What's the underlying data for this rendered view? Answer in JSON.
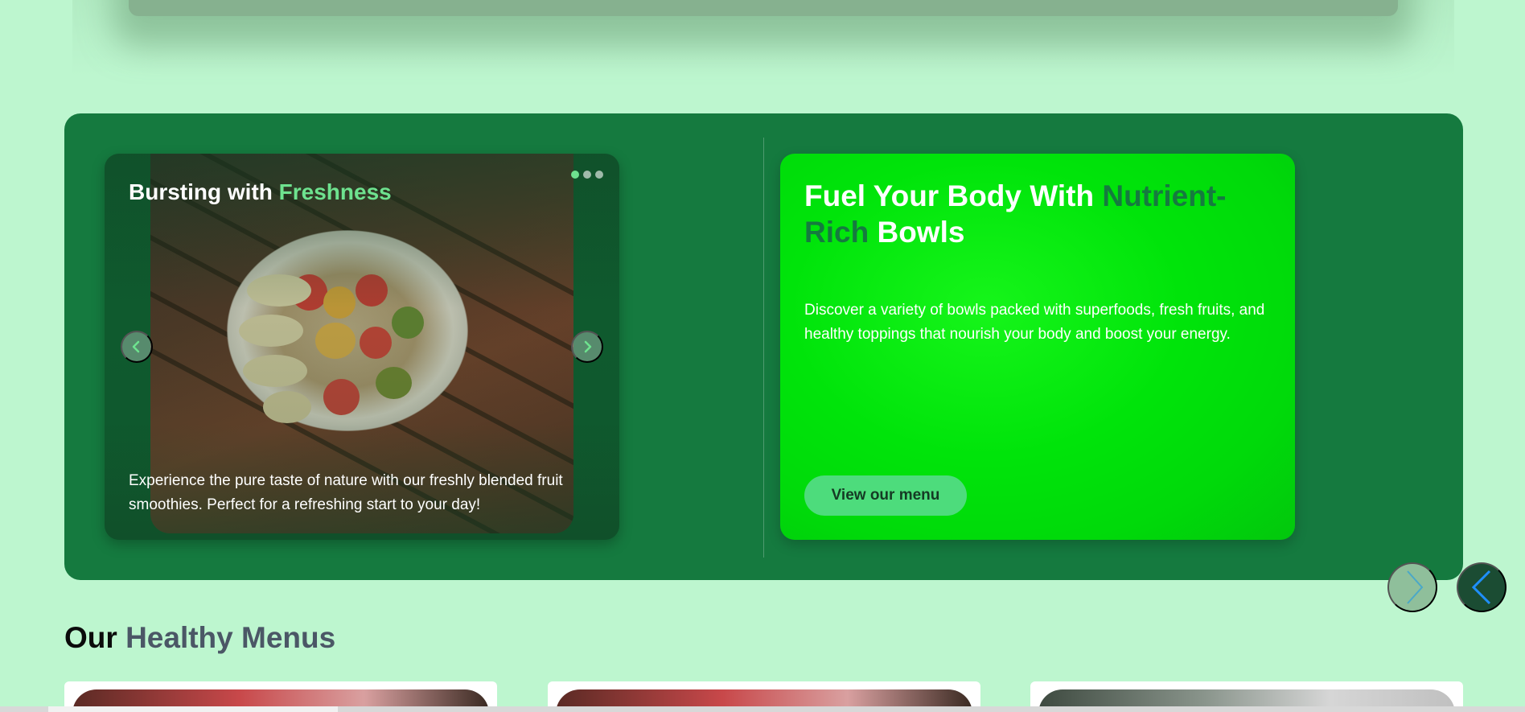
{
  "hero": {
    "slider": {
      "title_prefix": "Bursting with ",
      "title_accent": "Freshness",
      "description": "Experience the pure taste of nature with our freshly blended fruit smoothies. Perfect for a refreshing start to your day!",
      "prev_icon": "chevron-left-icon",
      "next_icon": "chevron-right-icon",
      "active_slide": 1,
      "slide_count": 3
    },
    "promo": {
      "title_part1": "Fuel Your Body With ",
      "title_accent": "Nutrient-Rich",
      "title_part2": " Bowls",
      "description": "Discover a variety of bowls packed with superfoods, fresh fruits, and healthy toppings that nourish your body and boost your energy.",
      "button_label": "View our menu"
    }
  },
  "carousel_nav": {
    "next_icon": "chevron-right-icon",
    "prev_icon": "chevron-left-icon"
  },
  "menus": {
    "title_prefix": "Our ",
    "title_accent": "Healthy Menus",
    "card_count": 3
  },
  "colors": {
    "page_bg": "#bdf6cf",
    "hero_bg": "#157a3f",
    "accent_light": "#6ee28f",
    "promo_bg": "#00e40a",
    "button_bg": "#4ddc7c"
  }
}
